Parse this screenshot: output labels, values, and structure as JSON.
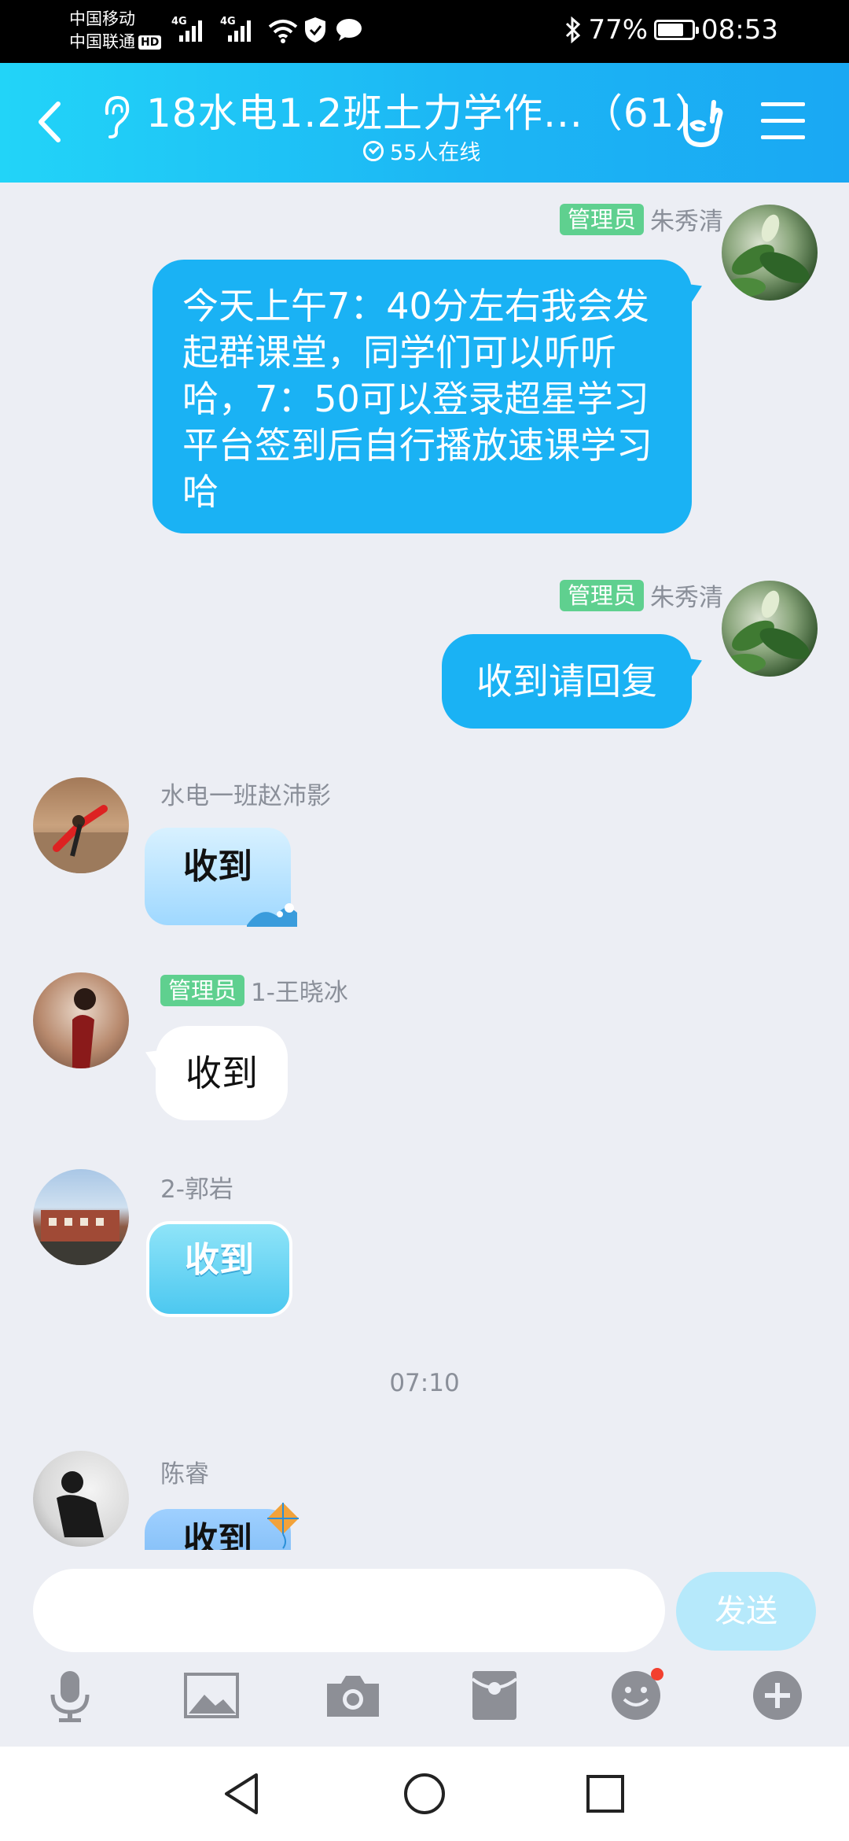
{
  "status_bar": {
    "carrier1": "中国移动",
    "carrier2": "中国联通",
    "hd_label": "HD",
    "net1": "4G",
    "net2": "4G",
    "battery_pct": "77%",
    "battery_level": 0.77,
    "time": "08:53"
  },
  "header": {
    "title": "18水电1.2班土力学作...",
    "count": "（61）",
    "online": "55人在线"
  },
  "messages": [
    {
      "sender": "朱秀清",
      "badge": "管理员",
      "text": "今天上午7：40分左右我会发起群课堂，同学们可以听听哈，7：50可以登录超星学习平台签到后自行播放速课学习哈"
    },
    {
      "sender": "朱秀清",
      "badge": "管理员",
      "text": "收到请回复"
    },
    {
      "sender": "水电一班赵沛影",
      "text": "收到"
    },
    {
      "sender": "1-王晓冰",
      "badge": "管理员",
      "text": "收到"
    },
    {
      "sender": "2-郭岩",
      "text": "收到"
    },
    {
      "sender": "陈睿",
      "text": "收到"
    }
  ],
  "timestamp": "07:10",
  "input": {
    "placeholder": "",
    "send_label": "发送"
  },
  "colors": {
    "header_start": "#22d4f8",
    "header_end": "#1aa8f3",
    "bubble_self": "#1ab2f4",
    "admin_badge": "#5fd08f",
    "send_disabled": "#b6e9fb"
  }
}
